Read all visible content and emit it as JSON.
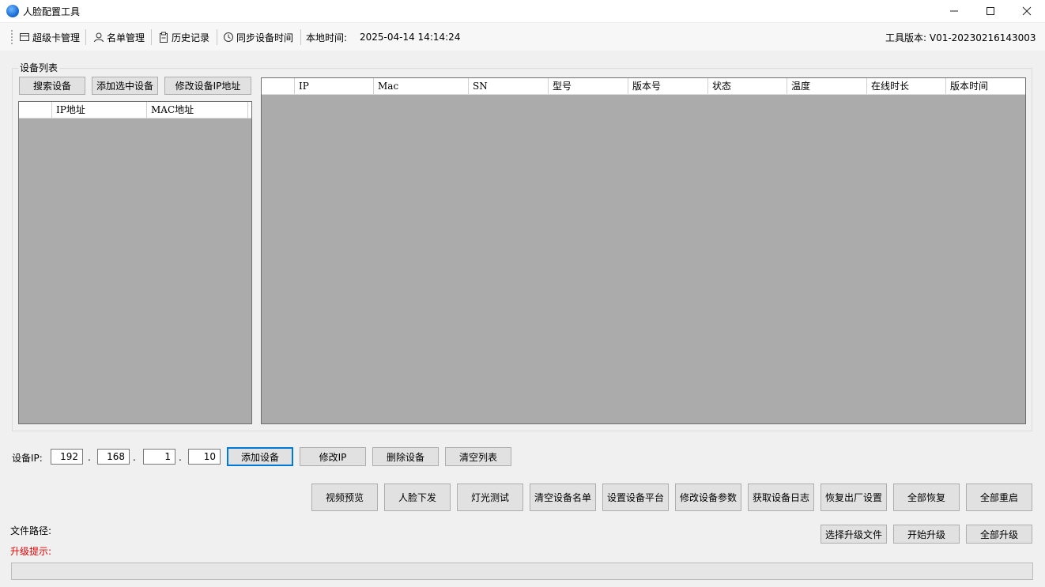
{
  "window": {
    "title": "人脸配置工具"
  },
  "toolbar": {
    "items": [
      {
        "label": "超级卡管理",
        "icon": "card-icon"
      },
      {
        "label": "名单管理",
        "icon": "user-icon"
      },
      {
        "label": "历史记录",
        "icon": "clipboard-icon"
      },
      {
        "label": "同步设备时间",
        "icon": "clock-icon"
      }
    ],
    "local_time_label": "本地时间:",
    "local_time_value": "2025-04-14 14:14:24",
    "version_text": "工具版本: V01-20230216143003"
  },
  "device_group": {
    "title": "设备列表",
    "buttons": {
      "search": "搜索设备",
      "add_selected": "添加选中设备",
      "modify_ip": "修改设备IP地址"
    },
    "scan_table": {
      "columns": [
        "",
        "IP地址",
        "MAC地址"
      ]
    },
    "device_table": {
      "columns": [
        "",
        "IP",
        "Mac",
        "SN",
        "型号",
        "版本号",
        "状态",
        "温度",
        "在线时长",
        "版本时间"
      ]
    }
  },
  "ip_row": {
    "label": "设备IP:",
    "octets": [
      "192",
      "168",
      "1",
      "10"
    ],
    "dots": [
      ".",
      ".",
      "."
    ],
    "buttons": {
      "add": "添加设备",
      "modify": "修改IP",
      "delete": "删除设备",
      "clear": "清空列表"
    }
  },
  "actions": {
    "buttons": [
      "视频预览",
      "人脸下发",
      "灯光测试",
      "清空设备名单",
      "设置设备平台",
      "修改设备参数",
      "获取设备日志",
      "恢复出厂设置",
      "全部恢复",
      "全部重启"
    ]
  },
  "upgrade": {
    "file_path_label": "文件路径:",
    "hint_label": "升级提示:",
    "hint_color": "#e00000",
    "buttons": {
      "select_file": "选择升级文件",
      "start": "开始升级",
      "all": "全部升级"
    },
    "progress": 0
  }
}
